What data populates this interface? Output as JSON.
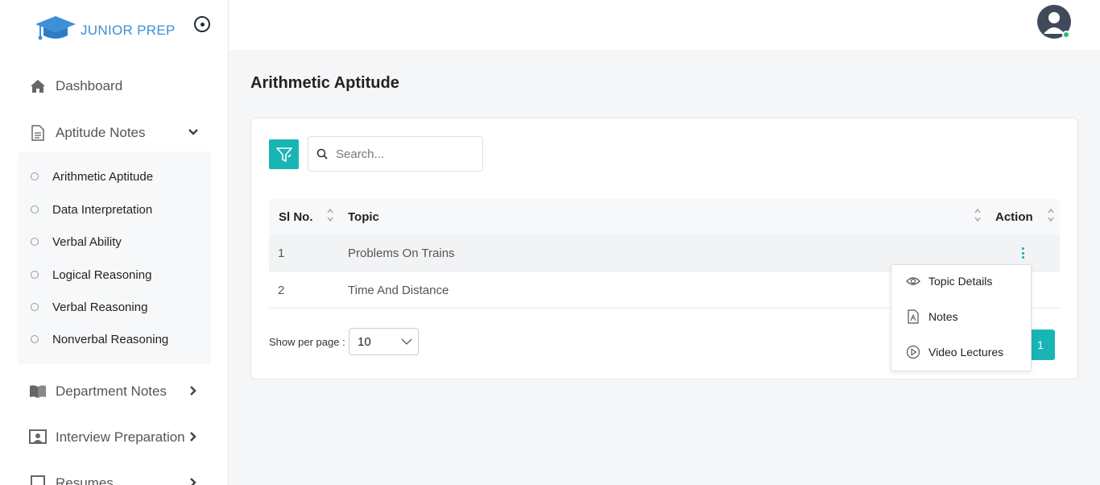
{
  "brand": {
    "name": "JUNIOR PREP",
    "icon": "graduation-cap-icon"
  },
  "sidebar": {
    "items": [
      {
        "label": "Dashboard",
        "icon": "home-icon"
      },
      {
        "label": "Aptitude Notes",
        "icon": "document-icon",
        "expanded": true
      },
      {
        "label": "Department Notes",
        "icon": "book-icon"
      },
      {
        "label": "Interview Preparation",
        "icon": "presenter-icon"
      },
      {
        "label": "Resumes",
        "icon": "resume-icon"
      }
    ],
    "submenu": [
      {
        "label": "Arithmetic Aptitude",
        "active": true
      },
      {
        "label": "Data Interpretation"
      },
      {
        "label": "Verbal Ability"
      },
      {
        "label": "Logical Reasoning"
      },
      {
        "label": "Verbal Reasoning"
      },
      {
        "label": "Nonverbal Reasoning"
      }
    ]
  },
  "page": {
    "title": "Arithmetic Aptitude"
  },
  "search": {
    "placeholder": "Search..."
  },
  "table": {
    "headers": {
      "sl": "Sl No.",
      "topic": "Topic",
      "action": "Action"
    },
    "rows": [
      {
        "sl": "1",
        "topic": "Problems On Trains"
      },
      {
        "sl": "2",
        "topic": "Time And Distance"
      }
    ]
  },
  "pagination": {
    "per_page_label": "Show per page :",
    "per_page_value": "10",
    "current_page": "1"
  },
  "action_menu": {
    "items": [
      {
        "label": "Topic Details",
        "icon": "eye-icon"
      },
      {
        "label": "Notes",
        "icon": "pdf-icon"
      },
      {
        "label": "Video Lectures",
        "icon": "play-icon"
      }
    ]
  },
  "colors": {
    "accent": "#19b5b5",
    "brand": "#3d8fd6",
    "online": "#2dbb6a"
  }
}
